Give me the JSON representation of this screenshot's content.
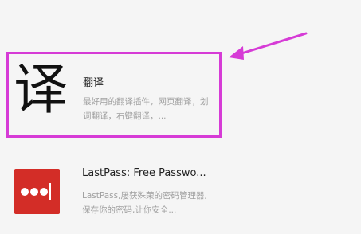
{
  "extensions": [
    {
      "icon": "translate-char-icon",
      "icon_glyph": "译",
      "name": "翻译",
      "description": "最好用的翻译插件，网页翻译，划词翻译，右键翻译，..."
    },
    {
      "icon": "lastpass-icon",
      "name": "LastPass: Free Passwo...",
      "description": "LastPass,屡获殊荣的密码管理器,保存你的密码,让你安全..."
    }
  ],
  "colors": {
    "highlight": "#d63bd6",
    "lastpass_red": "#d32d27"
  }
}
